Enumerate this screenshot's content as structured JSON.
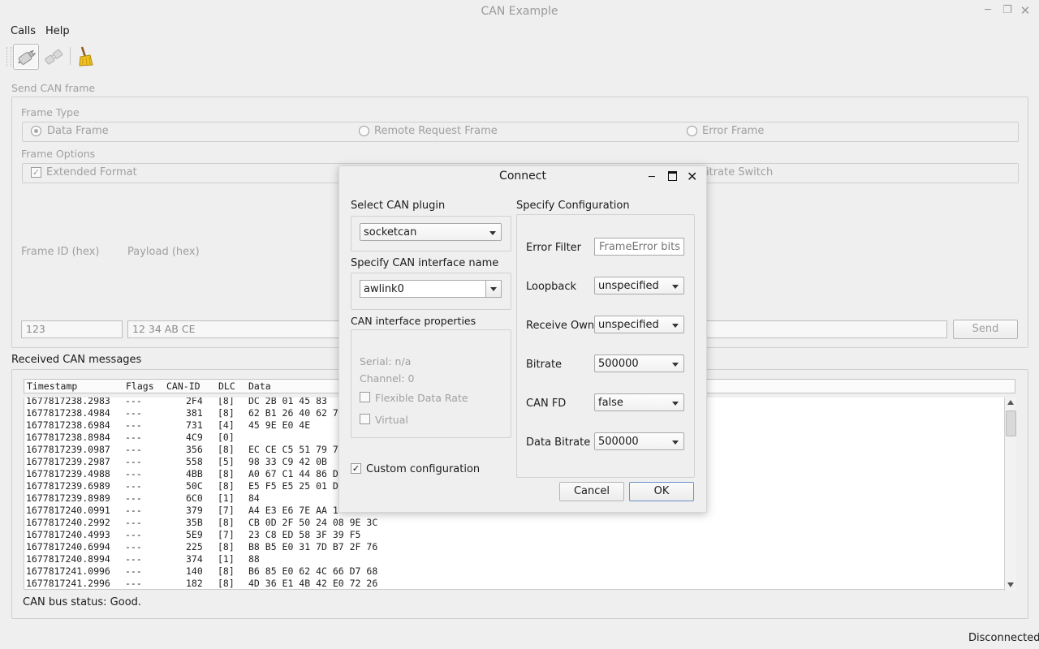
{
  "window": {
    "title": "CAN Example",
    "status_right": "Disconnected"
  },
  "menu": {
    "calls": "Calls",
    "help": "Help"
  },
  "toolbar": {
    "connect_icon": "connect-icon",
    "disconnect_icon": "disconnect-icon",
    "clear_icon": "broom-clear-icon"
  },
  "send": {
    "group_title": "Send CAN frame",
    "frame_type_title": "Frame Type",
    "data_frame": "Data Frame",
    "remote_frame": "Remote Request Frame",
    "error_frame": "Error Frame",
    "frame_options_title": "Frame Options",
    "extended_format": "Extended Format",
    "bitrate_switch_partial": "itrate Switch",
    "frame_id_label": "Frame ID (hex)",
    "payload_label": "Payload (hex)",
    "frame_id_value": "123",
    "payload_value": "12 34 AB CE",
    "send_button": "Send"
  },
  "received": {
    "title": "Received CAN messages",
    "columns": [
      "Timestamp",
      "Flags",
      "CAN-ID",
      "DLC",
      "Data"
    ],
    "rows": [
      [
        "1677817238.2983",
        "---",
        "2F4",
        "[8]",
        "DC 2B 01 45 83"
      ],
      [
        "1677817238.4984",
        "---",
        "381",
        "[8]",
        "62 B1 26 40 62 7"
      ],
      [
        "1677817238.6984",
        "---",
        "731",
        "[4]",
        "45 9E E0 4E"
      ],
      [
        "1677817238.8984",
        "---",
        "4C9",
        "[0]",
        ""
      ],
      [
        "1677817239.0987",
        "---",
        "356",
        "[8]",
        "EC CE C5 51 79 7"
      ],
      [
        "1677817239.2987",
        "---",
        "558",
        "[5]",
        "98 33 C9 42 0B"
      ],
      [
        "1677817239.4988",
        "---",
        "4BB",
        "[8]",
        "A0 67 C1 44 86 D"
      ],
      [
        "1677817239.6989",
        "---",
        "50C",
        "[8]",
        "E5 F5 E5 25 01 D"
      ],
      [
        "1677817239.8989",
        "---",
        "6C0",
        "[1]",
        "84"
      ],
      [
        "1677817240.0991",
        "---",
        "379",
        "[7]",
        "A4 E3 E6 7E AA 1"
      ],
      [
        "1677817240.2992",
        "---",
        "35B",
        "[8]",
        "CB 0D 2F 50 24 08 9E 3C"
      ],
      [
        "1677817240.4993",
        "---",
        "5E9",
        "[7]",
        "23 C8 ED 58 3F 39 F5"
      ],
      [
        "1677817240.6994",
        "---",
        "225",
        "[8]",
        "B8 B5 E0 31 7D B7 2F 76"
      ],
      [
        "1677817240.8994",
        "---",
        "374",
        "[1]",
        "88"
      ],
      [
        "1677817241.0996",
        "---",
        "140",
        "[8]",
        "B6 85 E0 62 4C 66 D7 68"
      ],
      [
        "1677817241.2996",
        "---",
        "182",
        "[8]",
        "4D 36 E1 4B 42 E0 72 26"
      ]
    ],
    "bus_status": "CAN bus status: Good."
  },
  "dialog": {
    "title": "Connect",
    "select_plugin_label": "Select CAN plugin",
    "plugin_value": "socketcan",
    "interface_label": "Specify CAN interface name",
    "interface_value": "awlink0",
    "properties_title": "CAN interface properties",
    "serial": "Serial: n/a",
    "channel": "Channel: 0",
    "flexible_data_rate": "Flexible Data Rate",
    "virtual": "Virtual",
    "custom_configuration": "Custom configuration",
    "spec_config_title": "Specify Configuration",
    "error_filter_label": "Error Filter",
    "error_filter_placeholder": "FrameError bits",
    "loopback_label": "Loopback",
    "loopback_value": "unspecified",
    "receive_own_label": "Receive Own",
    "receive_own_value": "unspecified",
    "bitrate_label": "Bitrate",
    "bitrate_value": "500000",
    "canfd_label": "CAN FD",
    "canfd_value": "false",
    "data_bitrate_label": "Data Bitrate",
    "data_bitrate_value": "500000",
    "cancel": "Cancel",
    "ok": "OK"
  }
}
